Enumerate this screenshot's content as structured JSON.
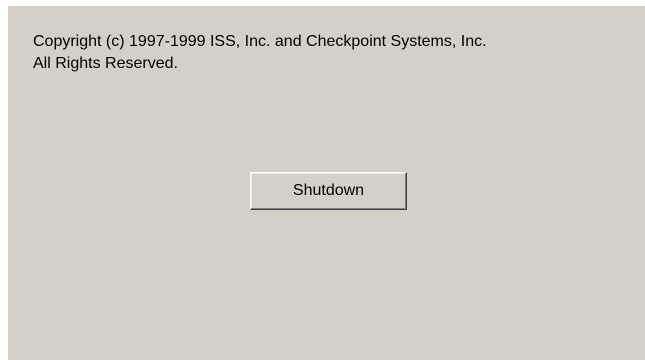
{
  "copyright": {
    "line1": "Copyright (c) 1997-1999 ISS, Inc. and Checkpoint Systems, Inc.",
    "line2": "All Rights Reserved."
  },
  "actions": {
    "shutdown_label": "Shutdown"
  },
  "colors": {
    "panel_background": "#d4d0c8",
    "page_background": "#ffffff",
    "text": "#000000"
  }
}
